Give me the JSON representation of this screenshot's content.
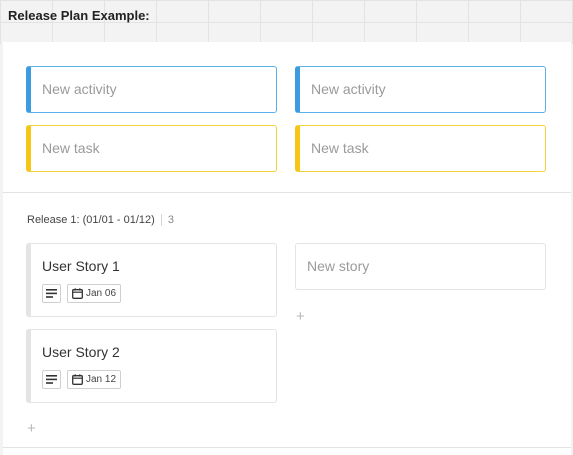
{
  "page": {
    "title": "Release Plan Example:"
  },
  "backlog": {
    "activities": [
      {
        "placeholder": "New activity"
      },
      {
        "placeholder": "New activity"
      }
    ],
    "tasks": [
      {
        "placeholder": "New task"
      },
      {
        "placeholder": "New task"
      }
    ]
  },
  "release": {
    "label": "Release 1: (01/01 - 01/12)",
    "count": "3",
    "stories": [
      {
        "title": "User Story 1",
        "date": "Jan 06"
      },
      {
        "title": "User Story 2",
        "date": "Jan 12"
      }
    ],
    "new_story_placeholder": "New story",
    "add_symbol": "+"
  },
  "colors": {
    "activity_accent": "#3d9be0",
    "task_accent": "#f5c518"
  }
}
